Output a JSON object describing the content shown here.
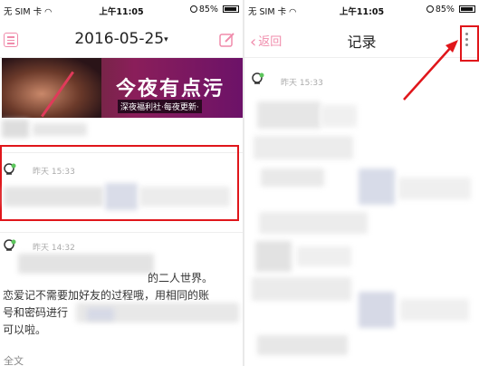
{
  "left": {
    "status": {
      "carrier": "无 SIM 卡",
      "time": "上午11:05",
      "battery": "85%",
      "battery_level": 0.85
    },
    "header": {
      "date": "2016-05-25",
      "caret": "▾"
    },
    "banner": {
      "title": "今夜有点污",
      "subtitle": "深夜福利社·每夜更新·"
    },
    "entries": [
      {
        "time": "昨天 15:33"
      },
      {
        "time": "昨天 14:32"
      }
    ],
    "entry_text": "恋爱记不需要加好友的过程哦，用相同的账号和密码进行...",
    "entry_text_lines": [
      "的二人世界。",
      "恋爱记不需要加好友的过程哦，用相同的账",
      "号和密码进行",
      "可以啦。"
    ],
    "more_label": "全文"
  },
  "right": {
    "status": {
      "carrier": "无 SIM 卡",
      "time": "上午11:05",
      "battery": "85%",
      "battery_level": 0.85
    },
    "header": {
      "back_label": "返回",
      "title": "记录"
    },
    "entries": [
      {
        "time": "昨天 15:33"
      }
    ]
  },
  "colors": {
    "accent": "#f08bab",
    "highlight": "#e0161b"
  },
  "icons": [
    "menu-icon",
    "edit-icon",
    "back-chevron-icon",
    "more-vertical-icon",
    "wifi-icon",
    "avatar-icon"
  ]
}
